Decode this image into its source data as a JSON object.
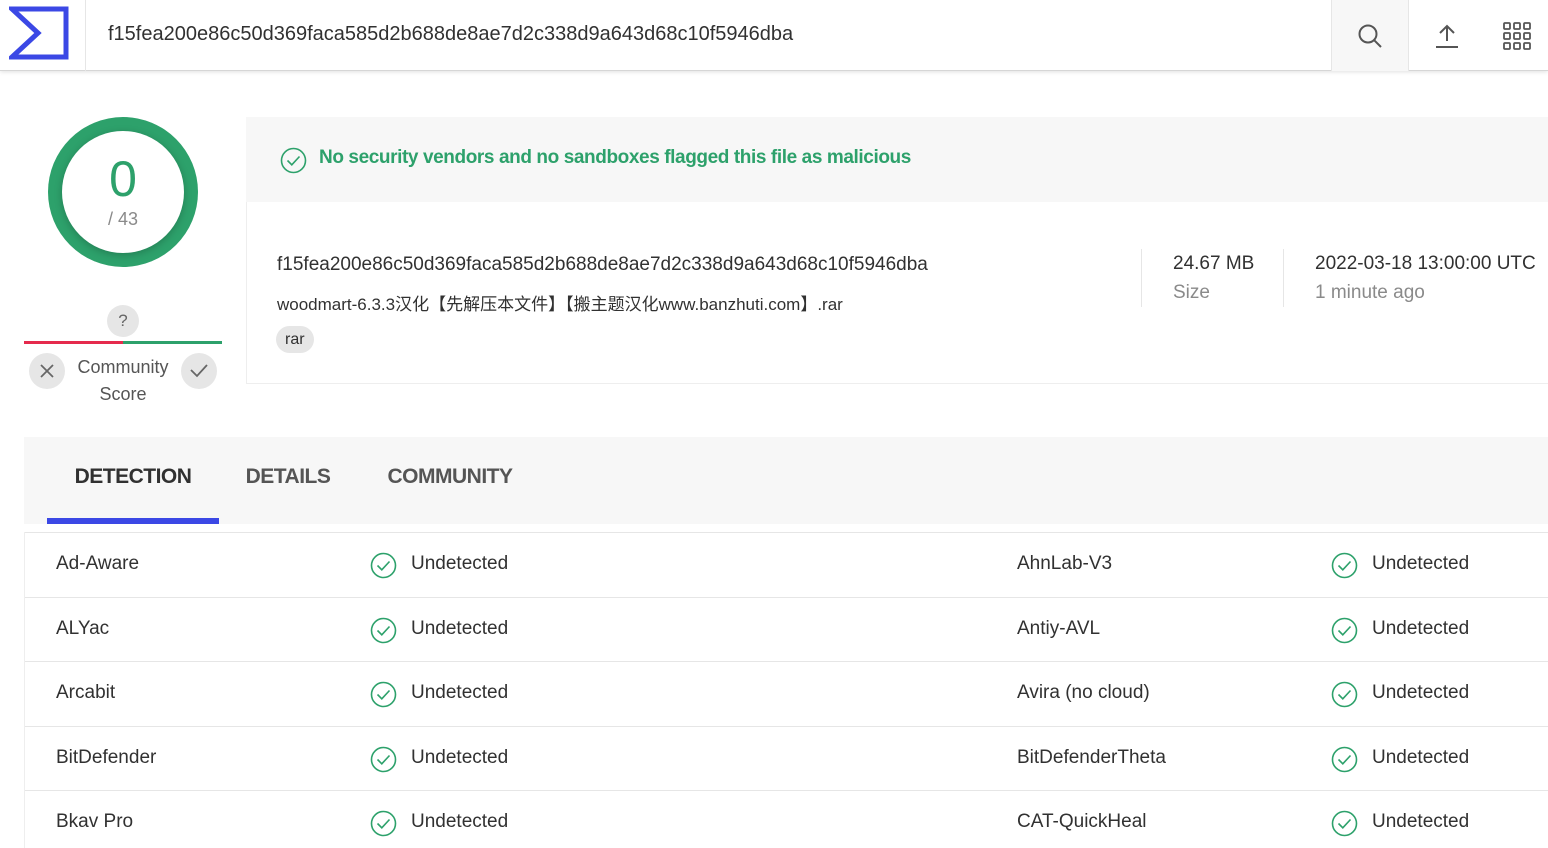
{
  "header": {
    "search_value": "f15fea200e86c50d369faca585d2b688de8ae7d2c338d9a643d68c10f5946dba"
  },
  "score": {
    "detected": "0",
    "total": "/ 43"
  },
  "community": {
    "unknown_label": "?",
    "label_line1": "Community",
    "label_line2": "Score"
  },
  "banner": {
    "message": "No security vendors and no sandboxes flagged this file as malicious"
  },
  "file": {
    "hash": "f15fea200e86c50d369faca585d2b688de8ae7d2c338d9a643d68c10f5946dba",
    "name": "woodmart-6.3.3汉化【先解压本文件】【搬主题汉化www.banzhuti.com】.rar",
    "tag": "rar",
    "size_value": "24.67 MB",
    "size_label": "Size",
    "date_value": "2022-03-18 13:00:00 UTC",
    "date_label": "1 minute ago"
  },
  "tabs": [
    {
      "label": "DETECTION"
    },
    {
      "label": "DETAILS"
    },
    {
      "label": "COMMUNITY"
    }
  ],
  "detections": [
    {
      "left_vendor": "Ad-Aware",
      "left_result": "Undetected",
      "right_vendor": "AhnLab-V3",
      "right_result": "Undetected"
    },
    {
      "left_vendor": "ALYac",
      "left_result": "Undetected",
      "right_vendor": "Antiy-AVL",
      "right_result": "Undetected"
    },
    {
      "left_vendor": "Arcabit",
      "left_result": "Undetected",
      "right_vendor": "Avira (no cloud)",
      "right_result": "Undetected"
    },
    {
      "left_vendor": "BitDefender",
      "left_result": "Undetected",
      "right_vendor": "BitDefenderTheta",
      "right_result": "Undetected"
    },
    {
      "left_vendor": "Bkav Pro",
      "left_result": "Undetected",
      "right_vendor": "CAT-QuickHeal",
      "right_result": "Undetected"
    }
  ],
  "colors": {
    "accent": "#3b48e5",
    "clean": "#2da16b",
    "malicious": "#e52a4d"
  },
  "icons": {
    "logo": "virustotal-logo-icon",
    "search": "search-icon",
    "upload": "upload-icon",
    "apps": "apps-grid-icon",
    "clean": "check-circle-icon",
    "vote_bad": "close-icon",
    "vote_good": "check-icon"
  }
}
